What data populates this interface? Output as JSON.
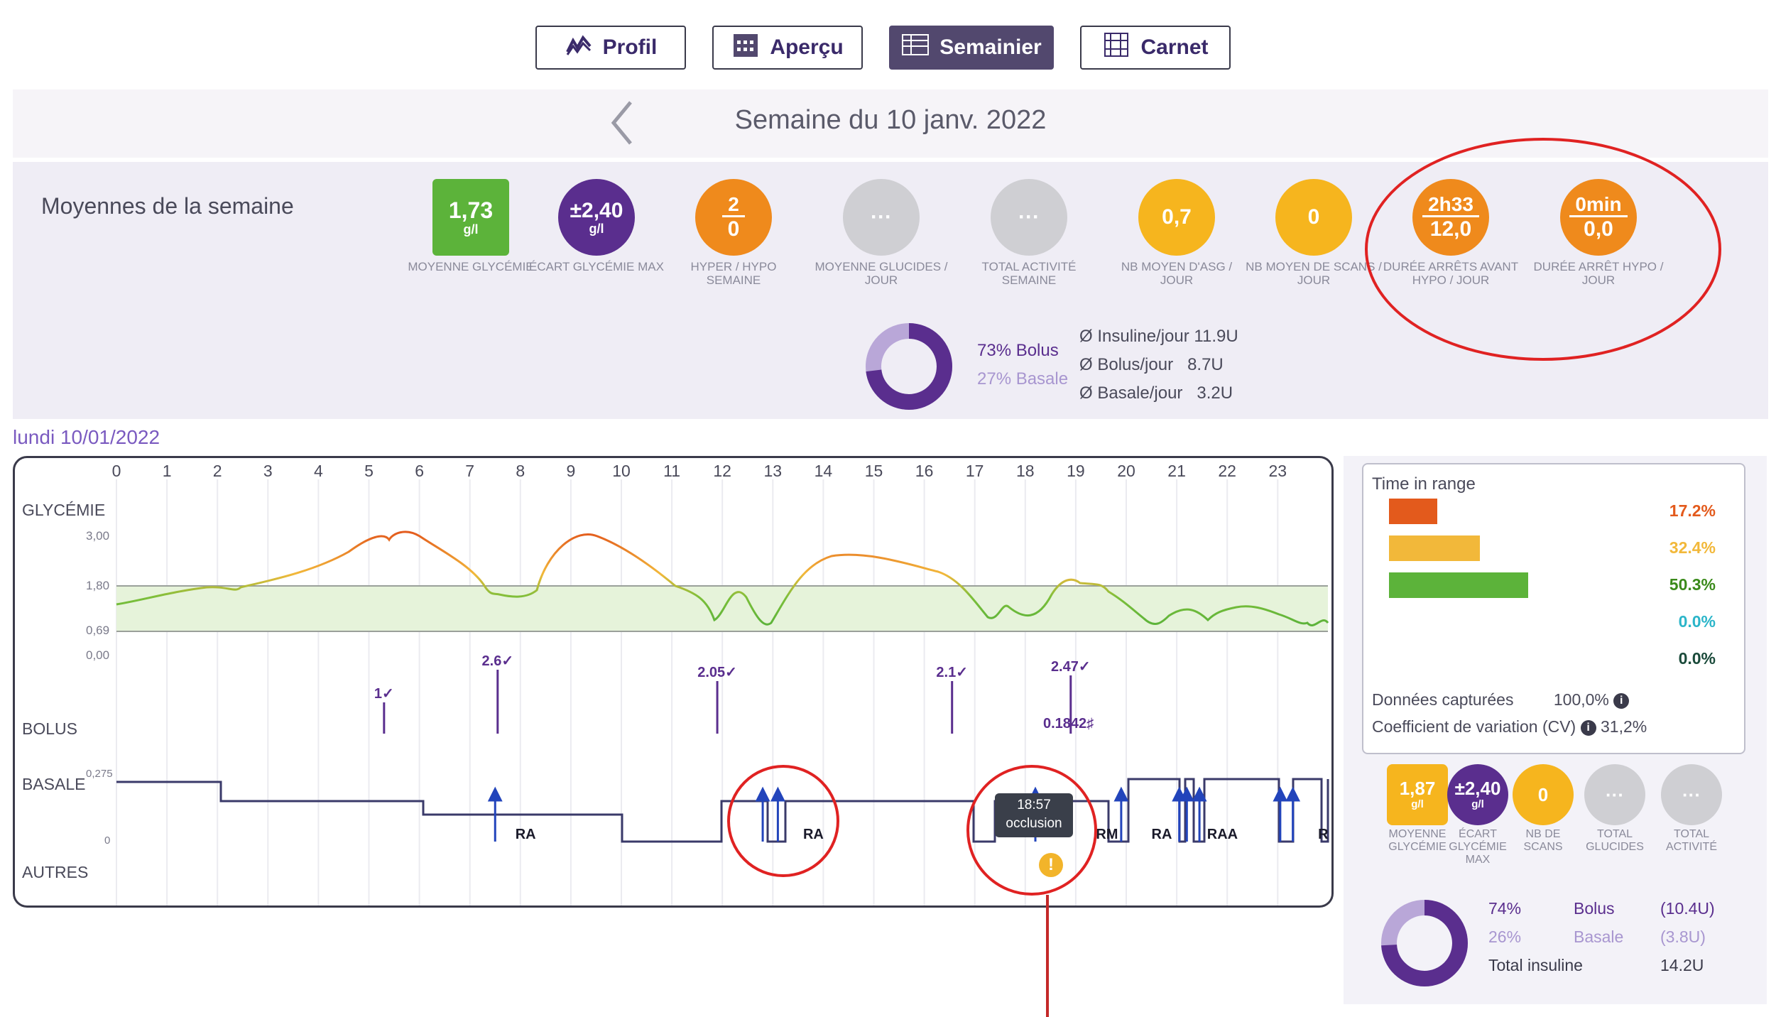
{
  "nav": {
    "tabs": [
      {
        "label": "Profil",
        "icon": "profile-wave-icon",
        "active": false
      },
      {
        "label": "Aperçu",
        "icon": "calendar-icon",
        "active": false
      },
      {
        "label": "Semainier",
        "icon": "weekly-grid-icon",
        "active": true
      },
      {
        "label": "Carnet",
        "icon": "logbook-icon",
        "active": false
      }
    ]
  },
  "week": {
    "title": "Semaine du 10 janv. 2022",
    "prev_icon": "chevron-left-icon"
  },
  "averages": {
    "label": "Moyennes de la semaine",
    "moyenne_glycemie": {
      "value": "1,73",
      "unit": "g/l",
      "label": "MOYENNE GLYCÉMIE",
      "color": "#5cb33a"
    },
    "ecart_glycemie": {
      "value": "±2,40",
      "unit": "g/l",
      "label": "ÉCART GLYCÉMIE MAX",
      "color": "#5a2e8e"
    },
    "hyper_hypo": {
      "top": "2",
      "bottom": "0",
      "label": "HYPER / HYPO SEMAINE",
      "color": "#ef8a1c"
    },
    "moyenne_glucides": {
      "value": "···",
      "label": "MOYENNE GLUCIDES / JOUR"
    },
    "total_activite": {
      "value": "···",
      "label": "TOTAL ACTIVITÉ SEMAINE"
    },
    "nb_asg": {
      "value": "0,7",
      "label": "NB MOYEN D'ASG / JOUR",
      "color": "#f6b51e"
    },
    "nb_scans": {
      "value": "0",
      "label": "NB MOYEN DE SCANS / JOUR",
      "color": "#f6b51e"
    },
    "duree_arrets_avant_hypo": {
      "top": "2h33",
      "bottom": "12,0",
      "label": "DURÉE ARRÊTS AVANT HYPO / JOUR",
      "color": "#ef8a1c"
    },
    "duree_arret_hypo": {
      "top": "0min",
      "bottom": "0,0",
      "label": "DURÉE ARRÊT HYPO / JOUR",
      "color": "#ef8a1c"
    },
    "insulin": {
      "bolus_pct": "73% Bolus",
      "basale_pct": "27% Basale",
      "bolus_fraction": 0.73,
      "insuline_jour": "Ø Insuline/jour 11.9U",
      "bolus_jour": "Ø Bolus/jour   8.7U",
      "basale_jour": "Ø Basale/jour   3.2U"
    }
  },
  "day": {
    "label": "lundi 10/01/2022",
    "hours": [
      "0",
      "1",
      "2",
      "3",
      "4",
      "5",
      "6",
      "7",
      "8",
      "9",
      "10",
      "11",
      "12",
      "13",
      "14",
      "15",
      "16",
      "17",
      "18",
      "19",
      "20",
      "21",
      "22",
      "23"
    ],
    "rows": {
      "glycemie": "GLYCÉMIE",
      "bolus": "BOLUS",
      "basale": "BASALE",
      "autres": "AUTRES"
    },
    "glycemie_ticks": [
      "3,00",
      "1,80",
      "0,69",
      "0,00"
    ],
    "basale_ticks": [
      "0,275",
      "0"
    ],
    "bolus_labels": [
      {
        "hour": 5.3,
        "text": "1✓"
      },
      {
        "hour": 7.55,
        "text": "2.6✓"
      },
      {
        "hour": 11.9,
        "text": "2.05✓"
      },
      {
        "hour": 16.55,
        "text": "2.1✓"
      },
      {
        "hour": 18.9,
        "text": "2.47✓"
      }
    ],
    "bolus_extra": "0.1842♯",
    "basale_markers": [
      {
        "hour": 7.9,
        "text": "RA"
      },
      {
        "hour": 13.6,
        "text": "RA"
      },
      {
        "hour": 19.4,
        "text": "RM"
      },
      {
        "hour": 20.5,
        "text": "RA"
      },
      {
        "hour": 21.6,
        "text": "RAA"
      },
      {
        "hour": 23.8,
        "text": "R"
      }
    ],
    "tooltip_time": "18:57",
    "tooltip_text": "occlusion",
    "alert_icon": "warning-icon"
  },
  "tir": {
    "title": "Time in range",
    "rows": [
      {
        "pct": "17.2%",
        "color": "#e35a1c",
        "fraction": 0.172
      },
      {
        "pct": "32.4%",
        "color": "#f2b83a",
        "fraction": 0.324
      },
      {
        "pct": "50.3%",
        "color": "#5cb33a",
        "fraction": 0.503
      },
      {
        "pct": "0.0%",
        "color": "#2bb5c9",
        "fraction": 0.0
      },
      {
        "pct": "0.0%",
        "color": "#1a4a3a",
        "fraction": 0.0
      }
    ],
    "donnees_label": "Données capturées",
    "donnees_value": "100,0%",
    "cv_label": "Coefficient de variation (CV)",
    "cv_value": "31,2%"
  },
  "day_stats": {
    "moyenne": {
      "value": "1,87",
      "unit": "g/l",
      "label": "MOYENNE GLYCÉMIE"
    },
    "ecart": {
      "value": "±2,40",
      "unit": "g/l",
      "label": "ÉCART GLYCÉMIE MAX"
    },
    "scans": {
      "value": "0",
      "label": "NB DE SCANS"
    },
    "glucides": {
      "value": "···",
      "label": "TOTAL GLUCIDES"
    },
    "activite": {
      "value": "···",
      "label": "TOTAL ACTIVITÉ"
    }
  },
  "day_insulin": {
    "bolus_pct": "74%",
    "bolus_label": "Bolus",
    "bolus_u": "(10.4U)",
    "basale_pct": "26%",
    "basale_label": "Basale",
    "basale_u": "(3.8U)",
    "total_label": "Total insuline",
    "total_u": "14.2U",
    "bolus_fraction": 0.74
  },
  "colors": {
    "purple": "#5a2e8e",
    "orange": "#ef8a1c",
    "annotation_red": "#e02222"
  }
}
